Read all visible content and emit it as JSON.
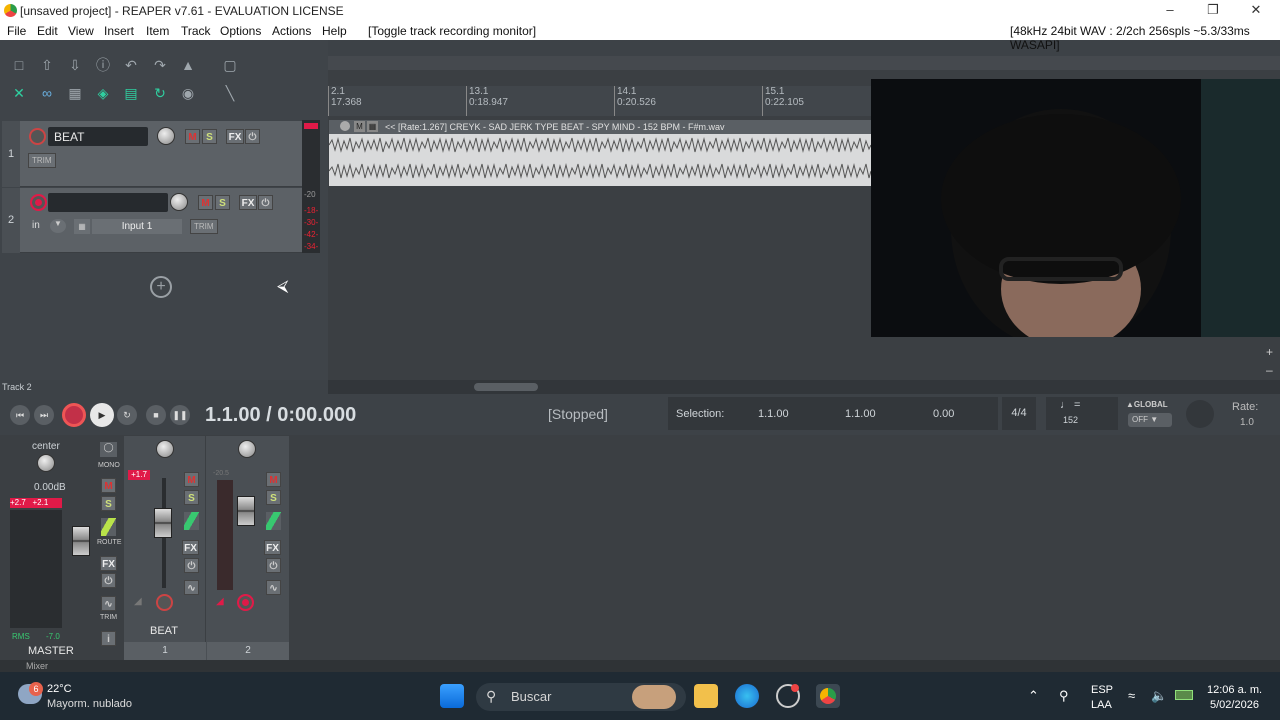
{
  "window": {
    "title": "[unsaved project] - REAPER v7.61 - EVALUATION LICENSE"
  },
  "menu": {
    "items": [
      "File",
      "Edit",
      "View",
      "Insert",
      "Item",
      "Track",
      "Options",
      "Actions",
      "Help"
    ],
    "action": "[Toggle track recording monitor]",
    "status": "[48kHz 24bit WAV : 2/2ch 256spls ~5.3/33ms WASAPI]"
  },
  "tracks": [
    {
      "num": "1",
      "name": "BEAT",
      "mute": "M",
      "solo": "S",
      "fx": "FX",
      "trim": "TRIM"
    },
    {
      "num": "2",
      "name": "",
      "mute": "M",
      "solo": "S",
      "fx": "FX",
      "in": "in",
      "input": "Input 1",
      "trim": "TRIM"
    }
  ],
  "meter_scale": [
    "-20",
    "-18-",
    "-30-",
    "-42-",
    "-34-"
  ],
  "ruler": [
    {
      "bar": "2.1",
      "time": "17.368"
    },
    {
      "bar": "13.1",
      "time": "0:18.947"
    },
    {
      "bar": "14.1",
      "time": "0:20.526"
    },
    {
      "bar": "15.1",
      "time": "0:22.105"
    }
  ],
  "item": {
    "label": "<< [Rate:1.267] CREYK - SAD JERK  TYPE BEAT - SPY MIND - 152 BPM - F#m.wav"
  },
  "track_label": "Track 2",
  "transport": {
    "time": "1.1.00 / 0:00.000",
    "state": "[Stopped]",
    "selection_label": "Selection:",
    "sel_start": "1.1.00",
    "sel_end": "1.1.00",
    "sel_len": "0.00",
    "timesig": "4/4",
    "bpm": "152",
    "global": "GLOBAL",
    "off": "OFF",
    "rate_label": "Rate:",
    "rate": "1.0"
  },
  "master": {
    "pan": "center",
    "db": "0.00dB",
    "peak_l": "+2.7",
    "peak_r": "+2.1",
    "rms": "RMS",
    "rms_val": "-7.0",
    "name": "MASTER",
    "mono": "MONO",
    "route": "ROUTE",
    "fx": "FX",
    "trim": "TRIM",
    "m": "M",
    "s": "S"
  },
  "mixer_strips": [
    {
      "name": "BEAT",
      "num": "1",
      "peak": "+1.7"
    },
    {
      "name": "",
      "num": "2",
      "peak": "-20.5"
    }
  ],
  "mixer_tab": "Mixer",
  "taskbar": {
    "temp": "22°C",
    "weather": "Mayorm. nublado",
    "badge": "6",
    "search": "Buscar",
    "lang1": "ESP",
    "lang2": "LAA",
    "time": "12:06 a. m.",
    "date": "5/02/2026"
  }
}
